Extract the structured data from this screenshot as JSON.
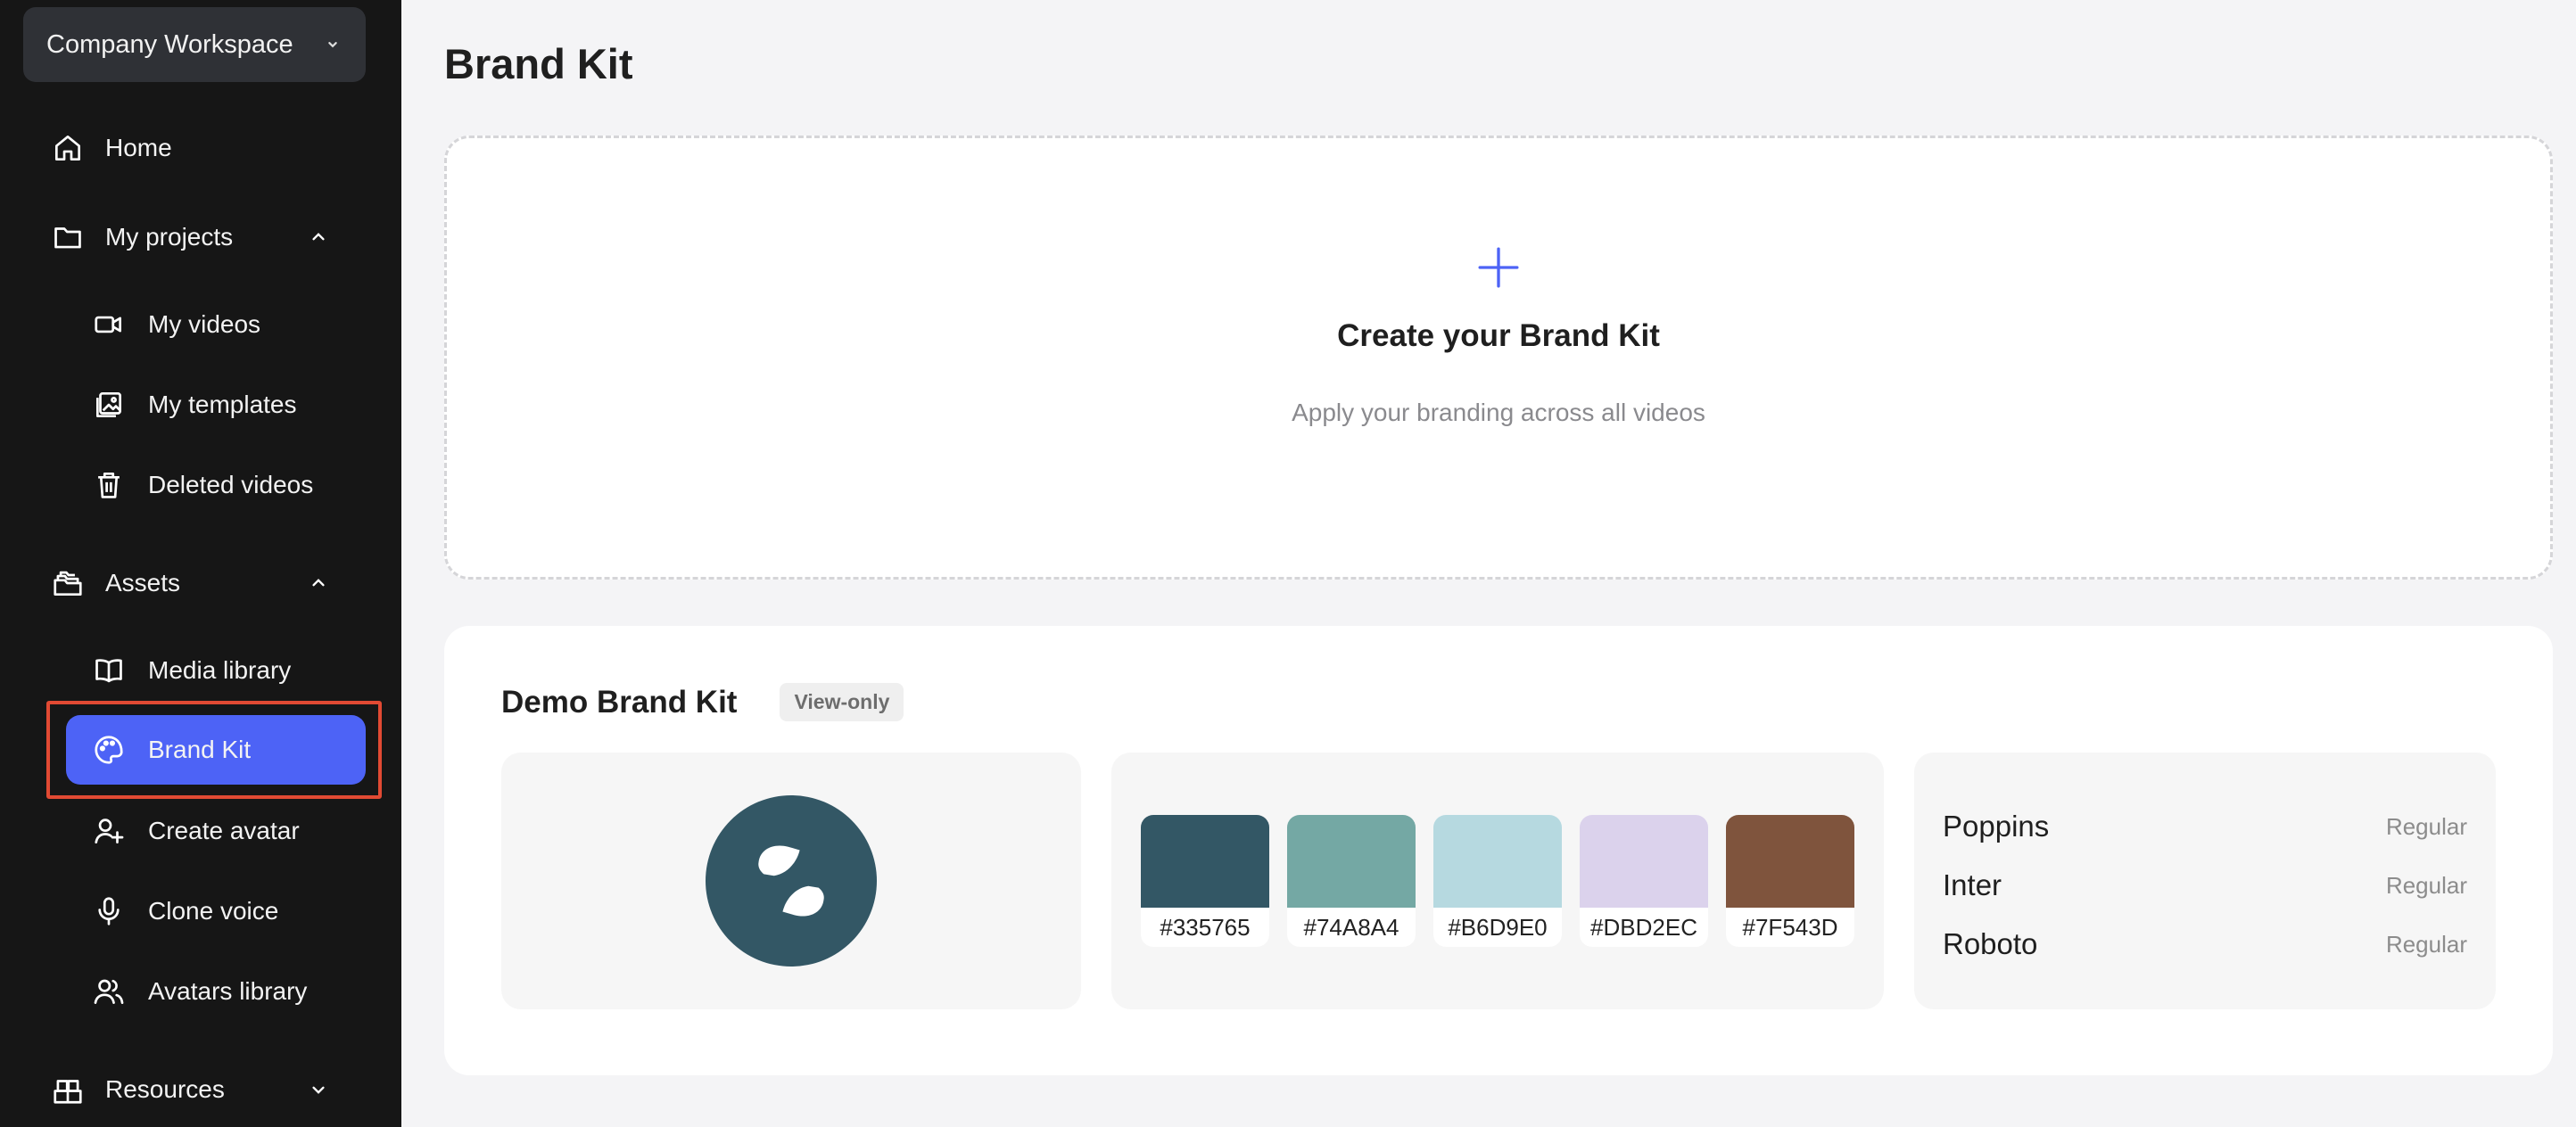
{
  "sidebar": {
    "workspace": "Company Workspace",
    "home": "Home",
    "my_projects": "My projects",
    "my_videos": "My videos",
    "my_templates": "My templates",
    "deleted_videos": "Deleted videos",
    "assets": "Assets",
    "media_library": "Media library",
    "brand_kit": "Brand Kit",
    "create_avatar": "Create avatar",
    "clone_voice": "Clone voice",
    "avatars_library": "Avatars library",
    "resources": "Resources",
    "active_color": "#4d63f6",
    "highlight_color": "#e14a33"
  },
  "main": {
    "title": "Brand Kit",
    "create": {
      "title": "Create your Brand Kit",
      "subtitle": "Apply your branding across all videos",
      "icon": "plus-icon",
      "accent": "#4d63f6"
    },
    "demo": {
      "title": "Demo Brand Kit",
      "badge": "View-only",
      "logo_color": "#335765",
      "colors": [
        "#335765",
        "#74A8A4",
        "#B6D9E0",
        "#DBD2EC",
        "#7F543D"
      ],
      "fonts": [
        {
          "name": "Poppins",
          "weight": "Regular"
        },
        {
          "name": "Inter",
          "weight": "Regular"
        },
        {
          "name": "Roboto",
          "weight": "Regular"
        }
      ]
    }
  }
}
